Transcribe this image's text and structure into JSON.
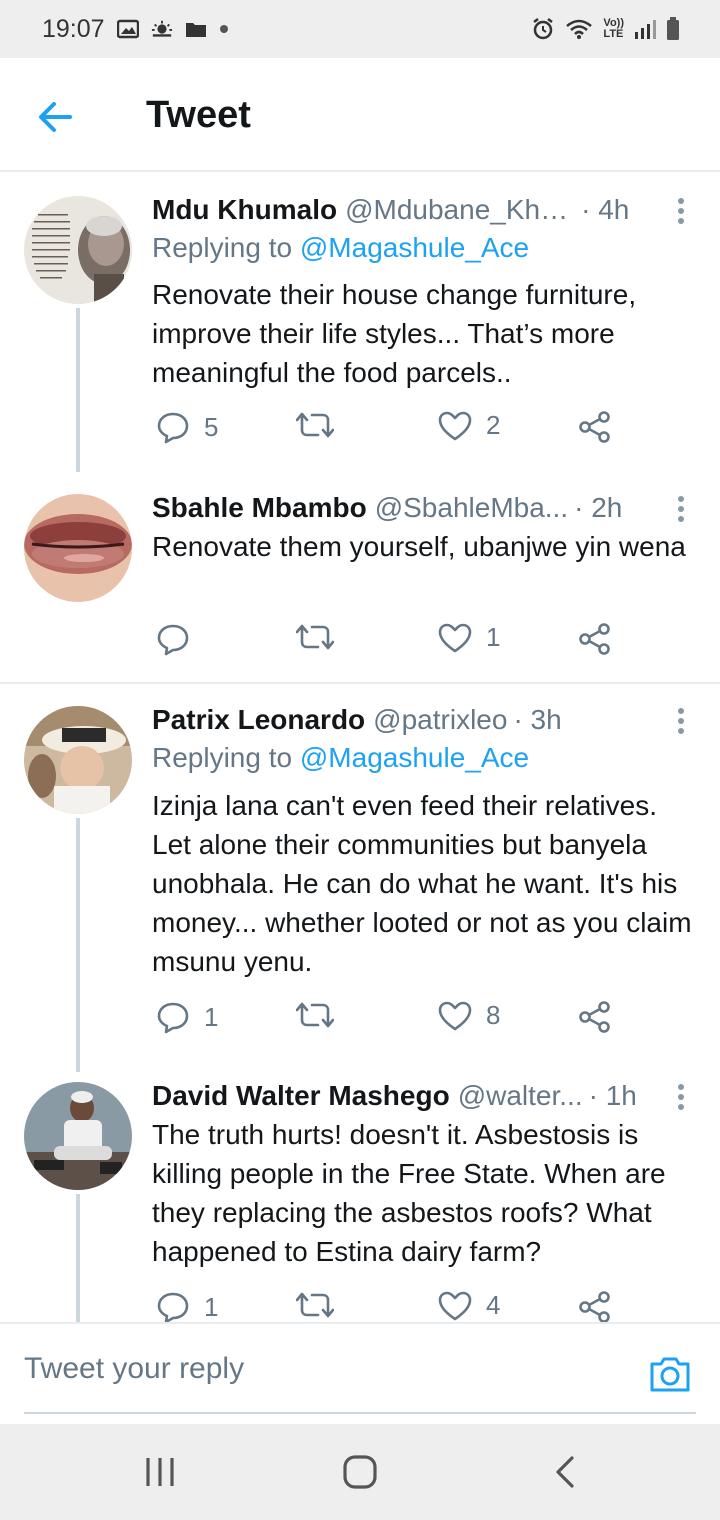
{
  "status_bar": {
    "time": "19:07",
    "icons": [
      "gallery-icon",
      "weather-icon",
      "folder-icon",
      "dot-icon",
      "alarm-icon",
      "wifi-icon",
      "volte-icon",
      "signal-icon",
      "battery-icon"
    ],
    "volte_label_top": "Vo))",
    "volte_label_bottom": "LTE"
  },
  "header": {
    "title": "Tweet",
    "back_icon": "arrow-left-icon",
    "accent_color": "#1da1f2"
  },
  "tweets": [
    {
      "name": "Mdu Khumalo",
      "handle": "@Mdubane_Khu...",
      "time": "· 4h",
      "reply_prefix": "Replying to",
      "reply_to": "@Magashule_Ace",
      "text": "Renovate their house change furniture, improve their life styles... That’s more meaningful the food parcels..",
      "replies": "5",
      "retweets": "",
      "likes": "2"
    },
    {
      "name": "Sbahle Mbambo",
      "handle": "@SbahleMba...",
      "time": "· 2h",
      "text": "Renovate them yourself, ubanjwe yin wena",
      "replies": "",
      "retweets": "",
      "likes": "1"
    },
    {
      "name": "Patrix Leonardo",
      "handle": "@patrixleo",
      "time": "· 3h",
      "reply_prefix": "Replying to",
      "reply_to": "@Magashule_Ace",
      "text": "Izinja lana can't even feed their relatives. Let alone their communities but banyela unobhala. He can do what he want. It's his money... whether looted or not as you claim msunu yenu.",
      "replies": "1",
      "retweets": "",
      "likes": "8"
    },
    {
      "name": "David Walter Mashego",
      "handle": "@walter...",
      "time": "· 1h",
      "text": "The truth hurts! doesn't it. Asbestosis is killing people in the Free State. When are they replacing the asbestos roofs? What happened to Estina dairy farm?",
      "replies": "1",
      "retweets": "",
      "likes": "4"
    }
  ],
  "reply_bar": {
    "placeholder": "Tweet your reply",
    "camera_icon": "camera-icon"
  },
  "nav_bar": {
    "icons": [
      "recent-apps-icon",
      "home-icon",
      "back-icon"
    ]
  }
}
